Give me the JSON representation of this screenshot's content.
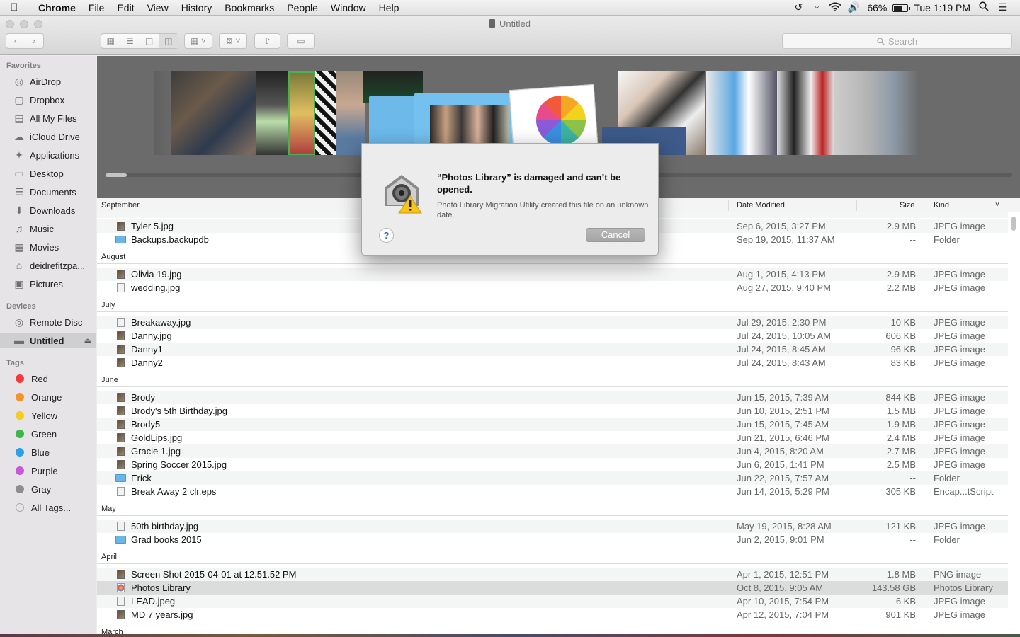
{
  "menubar": {
    "app": "Chrome",
    "items": [
      "File",
      "Edit",
      "View",
      "History",
      "Bookmarks",
      "People",
      "Window",
      "Help"
    ],
    "battery_percent": "66%",
    "battery_level": 0.66,
    "clock": "Tue 1:19 PM"
  },
  "window": {
    "title": "Untitled",
    "search_placeholder": "Search"
  },
  "sidebar": {
    "favorites_header": "Favorites",
    "favorites": [
      {
        "label": "AirDrop",
        "icon": "airdrop-icon"
      },
      {
        "label": "Dropbox",
        "icon": "dropbox-icon"
      },
      {
        "label": "All My Files",
        "icon": "all-files-icon"
      },
      {
        "label": "iCloud Drive",
        "icon": "cloud-icon"
      },
      {
        "label": "Applications",
        "icon": "applications-icon"
      },
      {
        "label": "Desktop",
        "icon": "desktop-icon"
      },
      {
        "label": "Documents",
        "icon": "documents-icon"
      },
      {
        "label": "Downloads",
        "icon": "download-icon"
      },
      {
        "label": "Music",
        "icon": "music-icon"
      },
      {
        "label": "Movies",
        "icon": "movies-icon"
      },
      {
        "label": "deidrefitzpa...",
        "icon": "home-icon"
      },
      {
        "label": "Pictures",
        "icon": "camera-icon"
      }
    ],
    "devices_header": "Devices",
    "devices": [
      {
        "label": "Remote Disc",
        "icon": "disc-icon"
      },
      {
        "label": "Untitled",
        "icon": "drive-icon"
      }
    ],
    "tags_header": "Tags",
    "tags": [
      {
        "label": "Red",
        "color": "#f23c3c"
      },
      {
        "label": "Orange",
        "color": "#f7912a"
      },
      {
        "label": "Yellow",
        "color": "#f5cc1f"
      },
      {
        "label": "Green",
        "color": "#3cb84a"
      },
      {
        "label": "Blue",
        "color": "#2c9fe8"
      },
      {
        "label": "Purple",
        "color": "#c55ad6"
      },
      {
        "label": "Gray",
        "color": "#8e8e8e"
      },
      {
        "label": "All Tags...",
        "color": ""
      }
    ]
  },
  "list": {
    "headers": {
      "name": "September",
      "date": "Date Modified",
      "size": "Size",
      "kind": "Kind"
    },
    "rows": [
      {
        "type": "row",
        "name": "Tyler 5.jpg",
        "date": "Sep 6, 2015, 3:27 PM",
        "size": "2.9 MB",
        "kind": "JPEG image",
        "icon": "img"
      },
      {
        "type": "row",
        "name": "Backups.backupdb",
        "date": "Sep 19, 2015, 11:37 AM",
        "size": "--",
        "kind": "Folder",
        "icon": "folder"
      },
      {
        "type": "group",
        "label": "August"
      },
      {
        "type": "row",
        "name": "Olivia 19.jpg",
        "date": "Aug 1, 2015, 4:13 PM",
        "size": "2.9 MB",
        "kind": "JPEG image",
        "icon": "img"
      },
      {
        "type": "row",
        "name": "wedding.jpg",
        "date": "Aug 27, 2015, 9:40 PM",
        "size": "2.2 MB",
        "kind": "JPEG image",
        "icon": "blank"
      },
      {
        "type": "group",
        "label": "July"
      },
      {
        "type": "row",
        "name": "Breakaway.jpg",
        "date": "Jul 29, 2015, 2:30 PM",
        "size": "10 KB",
        "kind": "JPEG image",
        "icon": "blank"
      },
      {
        "type": "row",
        "name": "Danny.jpg",
        "date": "Jul 24, 2015, 10:05 AM",
        "size": "606 KB",
        "kind": "JPEG image",
        "icon": "img"
      },
      {
        "type": "row",
        "name": "Danny1",
        "date": "Jul 24, 2015, 8:45 AM",
        "size": "96 KB",
        "kind": "JPEG image",
        "icon": "img"
      },
      {
        "type": "row",
        "name": "Danny2",
        "date": "Jul 24, 2015, 8:43 AM",
        "size": "83 KB",
        "kind": "JPEG image",
        "icon": "img"
      },
      {
        "type": "group",
        "label": "June"
      },
      {
        "type": "row",
        "name": "Brody",
        "date": "Jun 15, 2015, 7:39 AM",
        "size": "844 KB",
        "kind": "JPEG image",
        "icon": "img"
      },
      {
        "type": "row",
        "name": "Brody's 5th Birthday.jpg",
        "date": "Jun 10, 2015, 2:51 PM",
        "size": "1.5 MB",
        "kind": "JPEG image",
        "icon": "img"
      },
      {
        "type": "row",
        "name": "Brody5",
        "date": "Jun 15, 2015, 7:45 AM",
        "size": "1.9 MB",
        "kind": "JPEG image",
        "icon": "img"
      },
      {
        "type": "row",
        "name": "GoldLips.jpg",
        "date": "Jun 21, 2015, 6:46 PM",
        "size": "2.4 MB",
        "kind": "JPEG image",
        "icon": "img"
      },
      {
        "type": "row",
        "name": "Gracie 1.jpg",
        "date": "Jun 4, 2015, 8:20 AM",
        "size": "2.7 MB",
        "kind": "JPEG image",
        "icon": "img"
      },
      {
        "type": "row",
        "name": "Spring Soccer 2015.jpg",
        "date": "Jun 6, 2015, 1:41 PM",
        "size": "2.5 MB",
        "kind": "JPEG image",
        "icon": "img"
      },
      {
        "type": "row",
        "name": "Erick",
        "date": "Jun 22, 2015, 7:57 AM",
        "size": "--",
        "kind": "Folder",
        "icon": "folder"
      },
      {
        "type": "row",
        "name": "Break Away 2 clr.eps",
        "date": "Jun 14, 2015, 5:29 PM",
        "size": "305 KB",
        "kind": "Encap...tScript",
        "icon": "blank"
      },
      {
        "type": "group",
        "label": "May"
      },
      {
        "type": "row",
        "name": "50th birthday.jpg",
        "date": "May 19, 2015, 8:28 AM",
        "size": "121 KB",
        "kind": "JPEG image",
        "icon": "blank"
      },
      {
        "type": "row",
        "name": "Grad books 2015",
        "date": "Jun 2, 2015, 9:01 PM",
        "size": "--",
        "kind": "Folder",
        "icon": "folder"
      },
      {
        "type": "group",
        "label": "April"
      },
      {
        "type": "row",
        "name": "Screen Shot 2015-04-01 at 12.51.52 PM",
        "date": "Apr 1, 2015, 12:51 PM",
        "size": "1.8 MB",
        "kind": "PNG image",
        "icon": "img"
      },
      {
        "type": "row",
        "name": "Photos Library",
        "date": "Oct 8, 2015, 9:05 AM",
        "size": "143.58 GB",
        "kind": "Photos Library",
        "icon": "lib",
        "selected": true
      },
      {
        "type": "row",
        "name": "LEAD.jpeg",
        "date": "Apr 10, 2015, 7:54 PM",
        "size": "6 KB",
        "kind": "JPEG image",
        "icon": "blank"
      },
      {
        "type": "row",
        "name": "MD 7 years.jpg",
        "date": "Apr 12, 2015, 7:04 PM",
        "size": "901 KB",
        "kind": "JPEG image",
        "icon": "img"
      },
      {
        "type": "group",
        "label": "March"
      }
    ]
  },
  "dialog": {
    "title": "“Photos Library” is damaged and can’t be opened.",
    "message": "Photo Library Migration Utility created this file on an unknown date.",
    "help_label": "?",
    "cancel_label": "Cancel"
  }
}
